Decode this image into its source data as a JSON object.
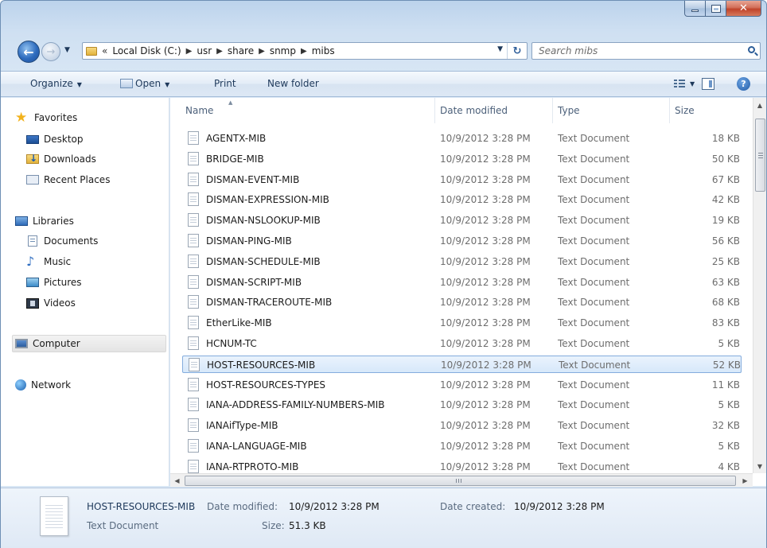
{
  "window": {
    "caption_buttons": {
      "minimize": "minimize-icon",
      "maximize": "maximize-icon",
      "close": "close-icon"
    }
  },
  "navbar": {
    "breadcrumb": [
      "«",
      "Local Disk (C:)",
      "usr",
      "share",
      "snmp",
      "mibs"
    ],
    "search_placeholder": "Search mibs"
  },
  "toolbar": {
    "organize": "Organize",
    "open": "Open",
    "print": "Print",
    "new_folder": "New folder"
  },
  "navpane": {
    "favorites": "Favorites",
    "favorites_items": [
      "Desktop",
      "Downloads",
      "Recent Places"
    ],
    "libraries": "Libraries",
    "libraries_items": [
      "Documents",
      "Music",
      "Pictures",
      "Videos"
    ],
    "computer": "Computer",
    "network": "Network"
  },
  "columns": {
    "name": "Name",
    "date": "Date modified",
    "type": "Type",
    "size": "Size"
  },
  "files": [
    {
      "name": "AGENTX-MIB",
      "date": "10/9/2012 3:28 PM",
      "type": "Text Document",
      "size": "18 KB"
    },
    {
      "name": "BRIDGE-MIB",
      "date": "10/9/2012 3:28 PM",
      "type": "Text Document",
      "size": "50 KB"
    },
    {
      "name": "DISMAN-EVENT-MIB",
      "date": "10/9/2012 3:28 PM",
      "type": "Text Document",
      "size": "67 KB"
    },
    {
      "name": "DISMAN-EXPRESSION-MIB",
      "date": "10/9/2012 3:28 PM",
      "type": "Text Document",
      "size": "42 KB"
    },
    {
      "name": "DISMAN-NSLOOKUP-MIB",
      "date": "10/9/2012 3:28 PM",
      "type": "Text Document",
      "size": "19 KB"
    },
    {
      "name": "DISMAN-PING-MIB",
      "date": "10/9/2012 3:28 PM",
      "type": "Text Document",
      "size": "56 KB"
    },
    {
      "name": "DISMAN-SCHEDULE-MIB",
      "date": "10/9/2012 3:28 PM",
      "type": "Text Document",
      "size": "25 KB"
    },
    {
      "name": "DISMAN-SCRIPT-MIB",
      "date": "10/9/2012 3:28 PM",
      "type": "Text Document",
      "size": "63 KB"
    },
    {
      "name": "DISMAN-TRACEROUTE-MIB",
      "date": "10/9/2012 3:28 PM",
      "type": "Text Document",
      "size": "68 KB"
    },
    {
      "name": "EtherLike-MIB",
      "date": "10/9/2012 3:28 PM",
      "type": "Text Document",
      "size": "83 KB"
    },
    {
      "name": "HCNUM-TC",
      "date": "10/9/2012 3:28 PM",
      "type": "Text Document",
      "size": "5 KB"
    },
    {
      "name": "HOST-RESOURCES-MIB",
      "date": "10/9/2012 3:28 PM",
      "type": "Text Document",
      "size": "52 KB"
    },
    {
      "name": "HOST-RESOURCES-TYPES",
      "date": "10/9/2012 3:28 PM",
      "type": "Text Document",
      "size": "11 KB"
    },
    {
      "name": "IANA-ADDRESS-FAMILY-NUMBERS-MIB",
      "date": "10/9/2012 3:28 PM",
      "type": "Text Document",
      "size": "5 KB"
    },
    {
      "name": "IANAifType-MIB",
      "date": "10/9/2012 3:28 PM",
      "type": "Text Document",
      "size": "32 KB"
    },
    {
      "name": "IANA-LANGUAGE-MIB",
      "date": "10/9/2012 3:28 PM",
      "type": "Text Document",
      "size": "5 KB"
    },
    {
      "name": "IANA-RTPROTO-MIB",
      "date": "10/9/2012 3:28 PM",
      "type": "Text Document",
      "size": "4 KB"
    }
  ],
  "details": {
    "name": "HOST-RESOURCES-MIB",
    "type": "Text Document",
    "date_modified_label": "Date modified:",
    "date_modified": "10/9/2012 3:28 PM",
    "date_created_label": "Date created:",
    "date_created": "10/9/2012 3:28 PM",
    "size_label": "Size:",
    "size": "51.3 KB"
  },
  "colors": {
    "selection": "#d7e8fa",
    "selection_border": "#84acdd",
    "accent": "#1e395b"
  }
}
